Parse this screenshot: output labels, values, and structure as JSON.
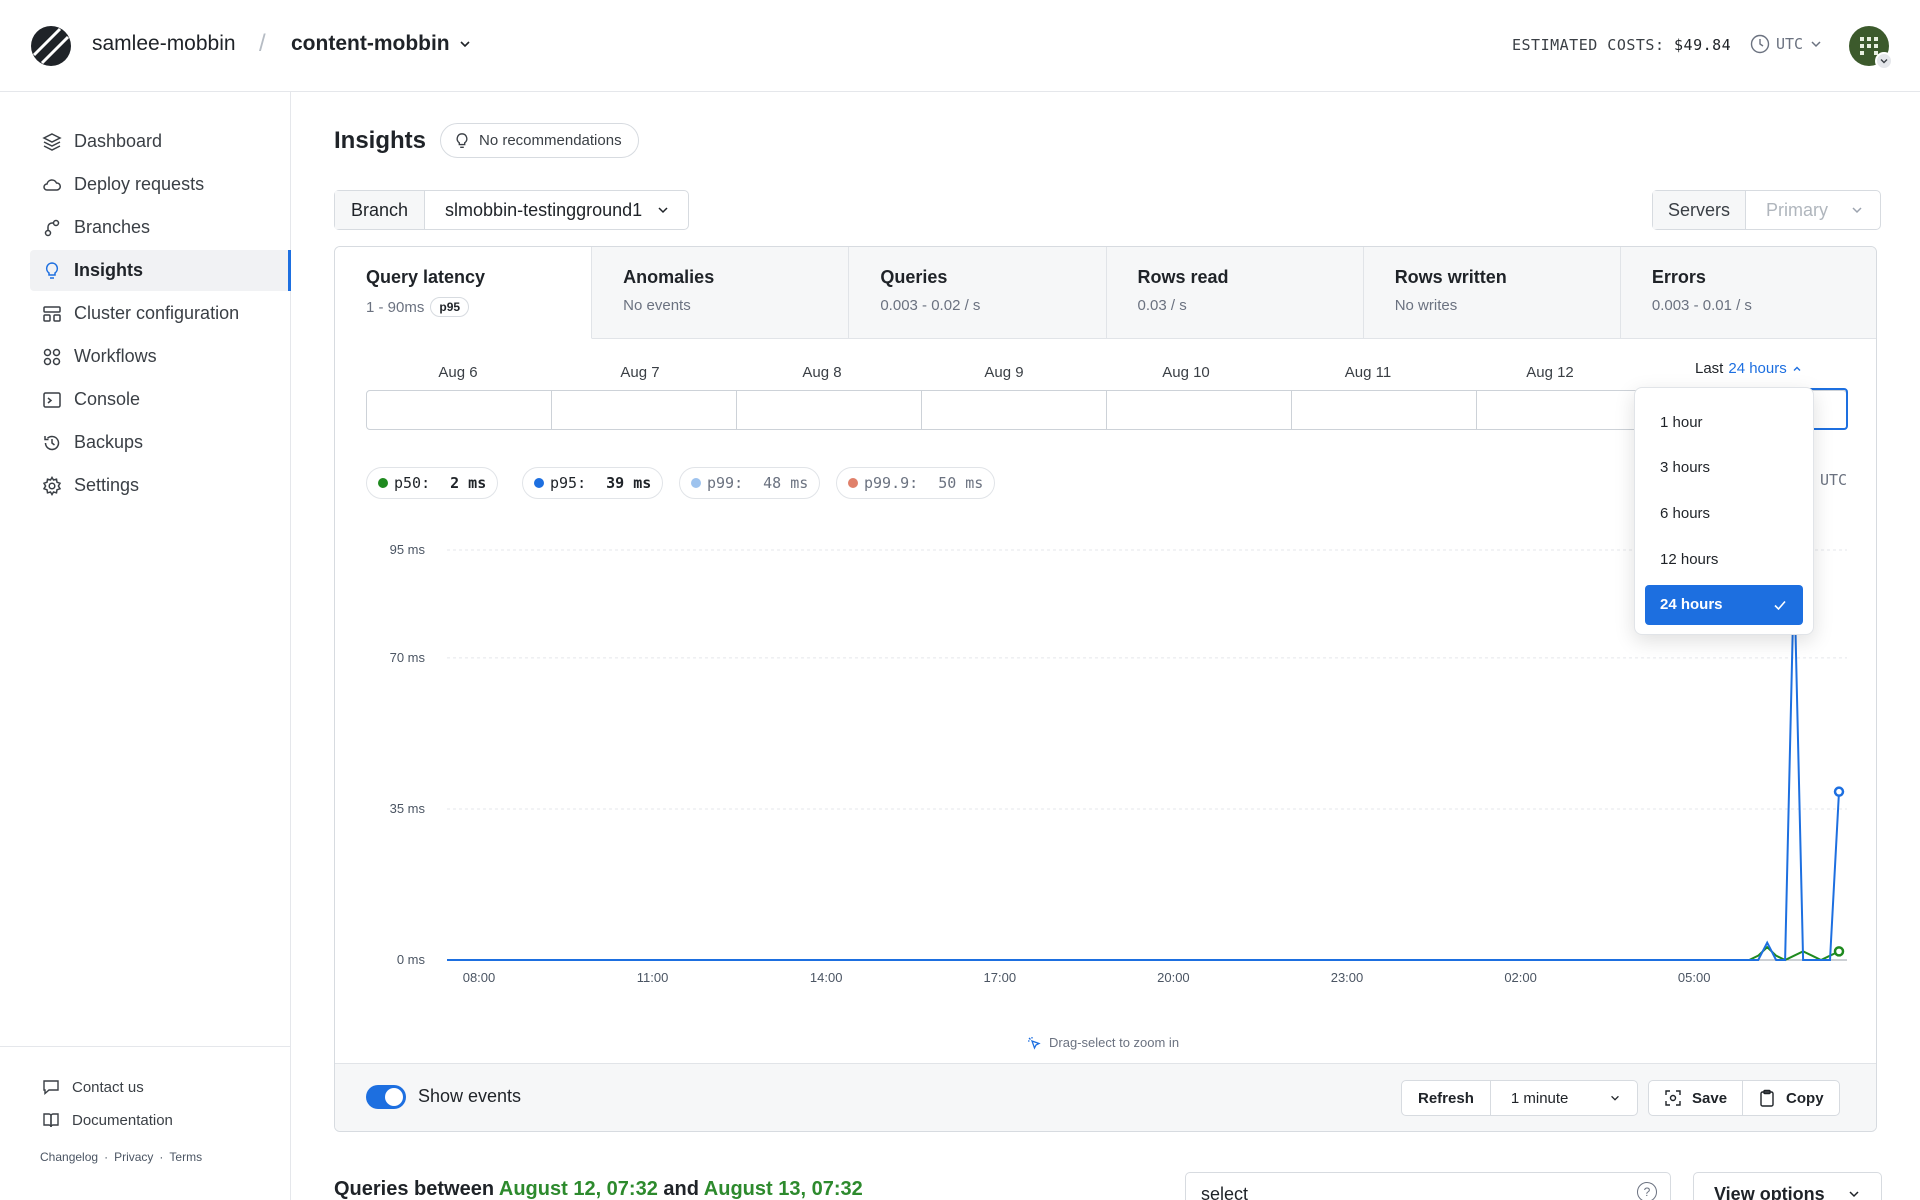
{
  "header": {
    "org": "samlee-mobbin",
    "separator": "/",
    "database": "content-mobbin",
    "estimated_costs_label": "ESTIMATED COSTS:",
    "estimated_costs_value": "$49.84",
    "timezone": "UTC"
  },
  "sidebar": {
    "items": [
      {
        "label": "Dashboard",
        "icon": "layers-icon"
      },
      {
        "label": "Deploy requests",
        "icon": "cloud-icon"
      },
      {
        "label": "Branches",
        "icon": "branch-icon"
      },
      {
        "label": "Insights",
        "icon": "lightbulb-icon",
        "active": true
      },
      {
        "label": "Cluster configuration",
        "icon": "cluster-icon"
      },
      {
        "label": "Workflows",
        "icon": "workflows-icon"
      },
      {
        "label": "Console",
        "icon": "terminal-icon"
      },
      {
        "label": "Backups",
        "icon": "history-icon"
      },
      {
        "label": "Settings",
        "icon": "gear-icon"
      }
    ],
    "help": {
      "contact": "Contact us",
      "docs": "Documentation"
    },
    "legal": {
      "changelog": "Changelog",
      "privacy": "Privacy",
      "terms": "Terms",
      "dot": "·"
    }
  },
  "main": {
    "title": "Insights",
    "recommendations": "No recommendations",
    "branch_label": "Branch",
    "branch_value": "slmobbin-testingground1",
    "servers_label": "Servers",
    "servers_value": "Primary"
  },
  "tabs": [
    {
      "title": "Query latency",
      "sub": "1 - 90ms",
      "badge": "p95",
      "active": true
    },
    {
      "title": "Anomalies",
      "sub": "No events"
    },
    {
      "title": "Queries",
      "sub": "0.003 - 0.02 / s"
    },
    {
      "title": "Rows read",
      "sub": "0.03 / s"
    },
    {
      "title": "Rows written",
      "sub": "No writes"
    },
    {
      "title": "Errors",
      "sub": "0.003 - 0.01 / s"
    }
  ],
  "timeline": {
    "days": [
      "Aug 6",
      "Aug 7",
      "Aug 8",
      "Aug 9",
      "Aug 10",
      "Aug 11",
      "Aug 12"
    ],
    "range_prefix": "Last",
    "range_value": "24 hours"
  },
  "legend": [
    {
      "name": "p50:",
      "value": "2 ms",
      "color": "#1f8a1f",
      "muted": false
    },
    {
      "name": "p95:",
      "value": "39 ms",
      "color": "#1d6fe0",
      "muted": false
    },
    {
      "name": "p99:",
      "value": "48 ms",
      "color": "#9ec3ee",
      "muted": true
    },
    {
      "name": "p99.9:",
      "value": "50 ms",
      "color": "#e0806a",
      "muted": true
    }
  ],
  "timezone_label": "UTC",
  "chart_data": {
    "type": "line",
    "y_ticks": [
      "95 ms",
      "70 ms",
      "35 ms",
      "0 ms"
    ],
    "x_ticks": [
      "08:00",
      "11:00",
      "14:00",
      "17:00",
      "20:00",
      "23:00",
      "02:00",
      "05:00"
    ],
    "ylim": [
      0,
      95
    ],
    "series": [
      {
        "name": "p50",
        "color": "#1f8a1f",
        "values": [
          0,
          0,
          0,
          0,
          0,
          0,
          0,
          0,
          0,
          0,
          0,
          0,
          0,
          0,
          0,
          0,
          0,
          0,
          0,
          0,
          0,
          0,
          0,
          0,
          0,
          0,
          0,
          0,
          0,
          0,
          0,
          0,
          0,
          0,
          0,
          0,
          0,
          0,
          0,
          0,
          0,
          0,
          0,
          0,
          0,
          0,
          0,
          0,
          0,
          0,
          0,
          0,
          0,
          0,
          0,
          0,
          0,
          0,
          0,
          0,
          0,
          0,
          0,
          0,
          0,
          0,
          0,
          0,
          0,
          0,
          0,
          0,
          0,
          0,
          0,
          0,
          0,
          0,
          0,
          0,
          0,
          0,
          0,
          0,
          0,
          0,
          0,
          0,
          0,
          0,
          0,
          0,
          0,
          0,
          0,
          0,
          0,
          0,
          0,
          0,
          0,
          0,
          0,
          0,
          0,
          0,
          0,
          0,
          0,
          0,
          0,
          0,
          0,
          0,
          0,
          0,
          0,
          0,
          0,
          0,
          0,
          0,
          0,
          0,
          0,
          0,
          0,
          0,
          0,
          0,
          0,
          0,
          0,
          0,
          0,
          0,
          0,
          0,
          0,
          0,
          0,
          0,
          0,
          0,
          0,
          0,
          1,
          3,
          1,
          0,
          1,
          2,
          1,
          0,
          1,
          2
        ]
      },
      {
        "name": "p95",
        "color": "#1d6fe0",
        "values": [
          0,
          0,
          0,
          0,
          0,
          0,
          0,
          0,
          0,
          0,
          0,
          0,
          0,
          0,
          0,
          0,
          0,
          0,
          0,
          0,
          0,
          0,
          0,
          0,
          0,
          0,
          0,
          0,
          0,
          0,
          0,
          0,
          0,
          0,
          0,
          0,
          0,
          0,
          0,
          0,
          0,
          0,
          0,
          0,
          0,
          0,
          0,
          0,
          0,
          0,
          0,
          0,
          0,
          0,
          0,
          0,
          0,
          0,
          0,
          0,
          0,
          0,
          0,
          0,
          0,
          0,
          0,
          0,
          0,
          0,
          0,
          0,
          0,
          0,
          0,
          0,
          0,
          0,
          0,
          0,
          0,
          0,
          0,
          0,
          0,
          0,
          0,
          0,
          0,
          0,
          0,
          0,
          0,
          0,
          0,
          0,
          0,
          0,
          0,
          0,
          0,
          0,
          0,
          0,
          0,
          0,
          0,
          0,
          0,
          0,
          0,
          0,
          0,
          0,
          0,
          0,
          0,
          0,
          0,
          0,
          0,
          0,
          0,
          0,
          0,
          0,
          0,
          0,
          0,
          0,
          0,
          0,
          0,
          0,
          0,
          0,
          0,
          0,
          0,
          0,
          0,
          0,
          0,
          0,
          0,
          0,
          0,
          4,
          0,
          0,
          90,
          0,
          0,
          0,
          0,
          39
        ]
      }
    ]
  },
  "chart_hint": "Drag-select to zoom in",
  "footer": {
    "show_events": "Show events",
    "refresh": "Refresh",
    "interval": "1 minute",
    "save": "Save",
    "copy": "Copy"
  },
  "range_dropdown": {
    "options": [
      "1 hour",
      "3 hours",
      "6 hours",
      "12 hours",
      "24 hours"
    ],
    "selected": "24 hours"
  },
  "queries": {
    "prefix": "Queries between",
    "start": "August 12, 07:32",
    "and": "and",
    "end": "August 13, 07:32",
    "search_value": "select",
    "help": "?",
    "view_options": "View options"
  }
}
